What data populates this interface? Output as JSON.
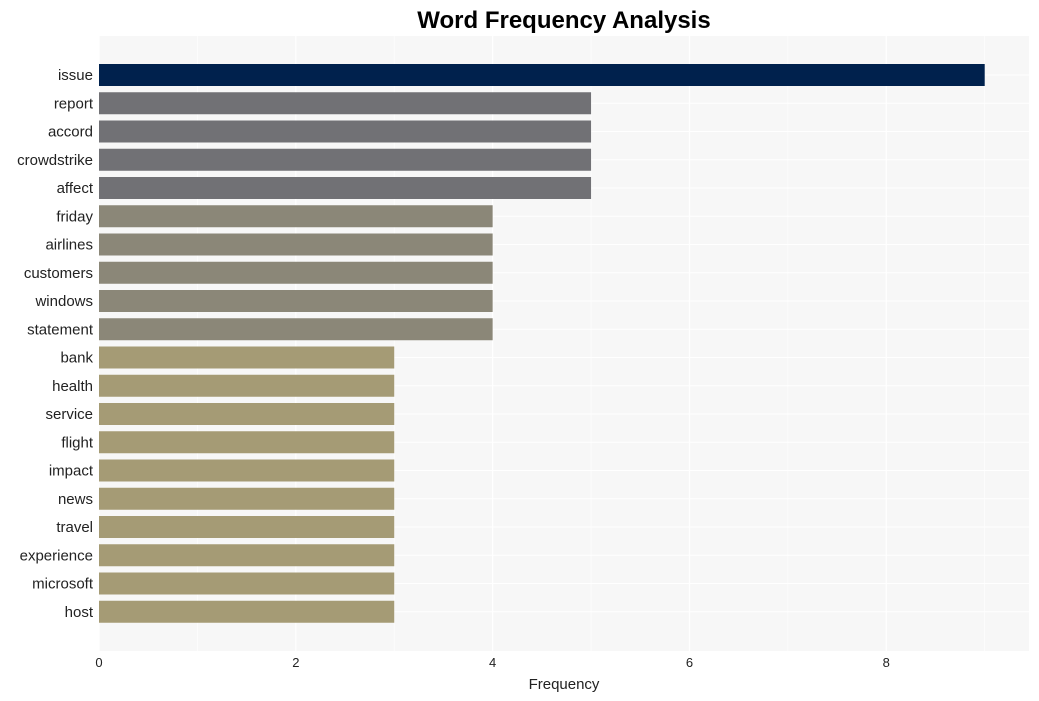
{
  "chart_data": {
    "type": "bar",
    "orientation": "horizontal",
    "title": "Word Frequency Analysis",
    "xlabel": "Frequency",
    "ylabel": "",
    "xlim": [
      0,
      9.45
    ],
    "xticks": [
      0,
      2,
      4,
      6,
      8
    ],
    "grid": true,
    "legend": "none",
    "categories": [
      "issue",
      "report",
      "accord",
      "crowdstrike",
      "affect",
      "friday",
      "airlines",
      "customers",
      "windows",
      "statement",
      "bank",
      "health",
      "service",
      "flight",
      "impact",
      "news",
      "travel",
      "experience",
      "microsoft",
      "host"
    ],
    "values": [
      9,
      5,
      5,
      5,
      5,
      4,
      4,
      4,
      4,
      4,
      3,
      3,
      3,
      3,
      3,
      3,
      3,
      3,
      3,
      3
    ],
    "color_by_value": {
      "9": "#00214d",
      "5": "#717175",
      "4": "#8b8778",
      "3": "#a59b75"
    },
    "plot_background": "#f7f7f7",
    "grid_color": "#ffffff"
  }
}
